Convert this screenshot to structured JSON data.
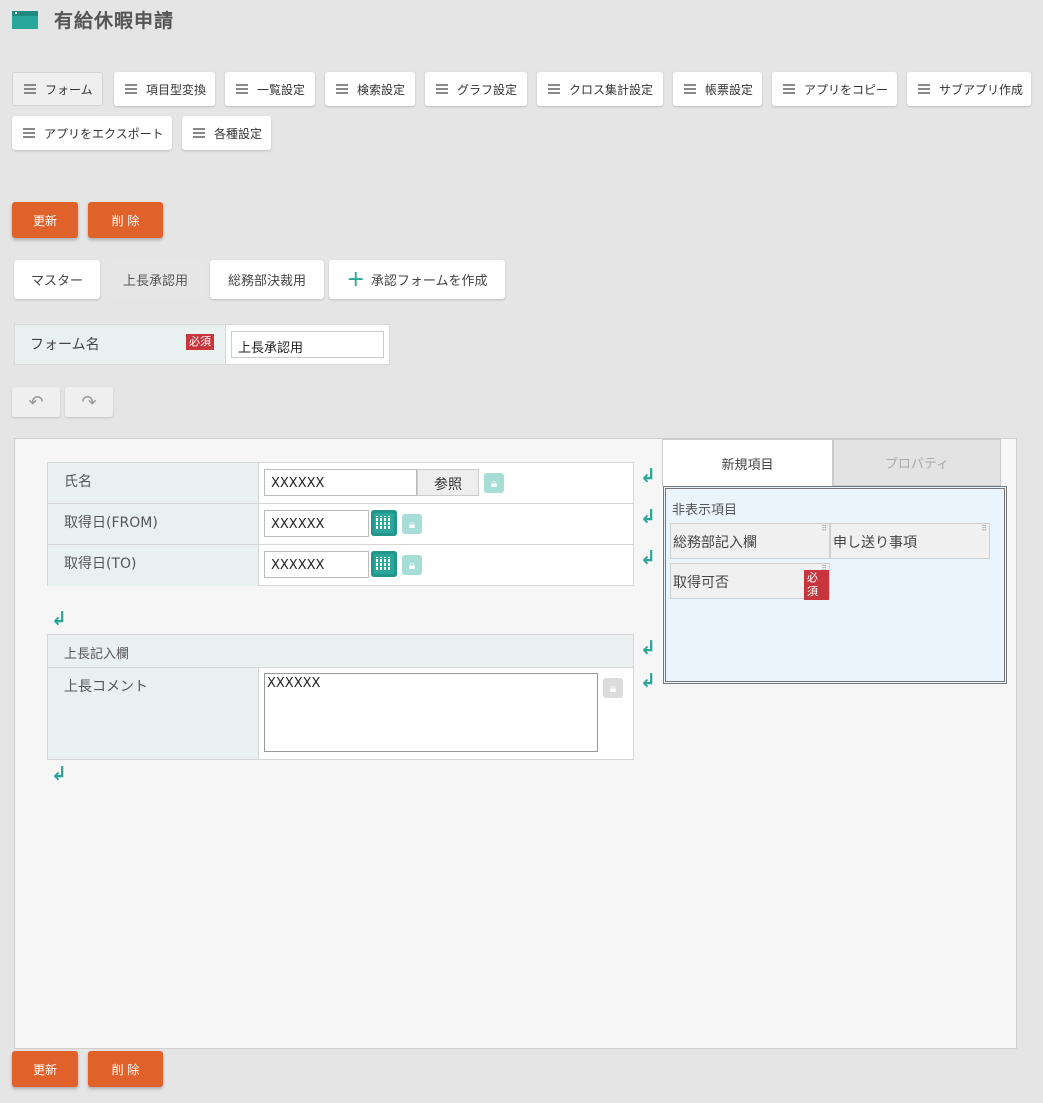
{
  "app": {
    "title": "有給休暇申請"
  },
  "menu": [
    "フォーム",
    "項目型変換",
    "一覧設定",
    "検索設定",
    "グラフ設定",
    "クロス集計設定",
    "帳票設定",
    "アプリをコピー",
    "サブアプリ作成",
    "アプリをエクスポート",
    "各種設定"
  ],
  "actions": {
    "update": "更新",
    "delete": "削 除"
  },
  "form_tabs": {
    "master": "マスター",
    "boss": "上長承認用",
    "general": "総務部決裁用",
    "create": "承認フォームを作成"
  },
  "form_name": {
    "label": "フォーム名",
    "required": "必須",
    "value": "上長承認用"
  },
  "undo": {
    "undo_icon": "undo-icon",
    "redo_icon": "redo-icon"
  },
  "fields": {
    "name": {
      "label": "氏名",
      "value": "XXXXXX",
      "ref_button": "参照"
    },
    "from": {
      "label": "取得日(FROM)",
      "value": "XXXXXX"
    },
    "to": {
      "label": "取得日(TO)",
      "value": "XXXXXX"
    },
    "section": {
      "label": "上長記入欄"
    },
    "comment": {
      "label": "上長コメント",
      "value": "XXXXXX"
    }
  },
  "panel": {
    "tab_new": "新規項目",
    "tab_props": "プロパティ",
    "hidden_title": "非表示項目",
    "chips": [
      "総務部記入欄",
      "申し送り事項",
      "取得可否"
    ],
    "required": "必須"
  },
  "colors": {
    "accent": "#2aa79b",
    "action": "#e0622a",
    "required": "#c9353d"
  }
}
